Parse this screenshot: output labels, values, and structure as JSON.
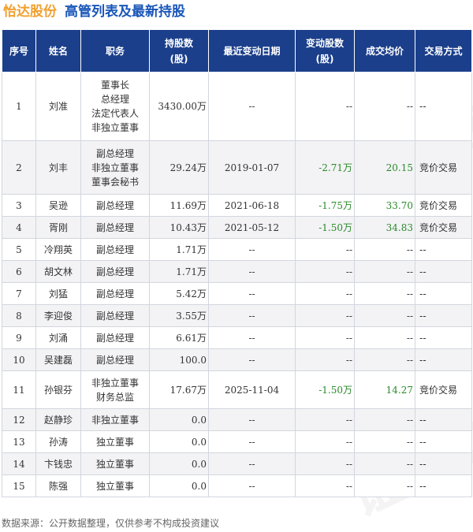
{
  "header": {
    "company": "怡达股份",
    "subtitle": "高管列表及最新持股"
  },
  "columns": [
    "序号",
    "姓名",
    "职务",
    "持股数\n(股)",
    "最近变动日期",
    "变动股数\n(股)",
    "成交均价",
    "交易方式"
  ],
  "rows": [
    {
      "no": "1",
      "name": "刘准",
      "positions": [
        "董事长",
        "总经理",
        "法定代表人",
        "非独立董事"
      ],
      "shares": "3430.00万",
      "date": "--",
      "change": "--",
      "price": "--",
      "method": "--"
    },
    {
      "no": "2",
      "name": "刘丰",
      "positions": [
        "副总经理",
        "非独立董事",
        "董事会秘书"
      ],
      "shares": "29.24万",
      "date": "2019-01-07",
      "change": "-2.71万",
      "price": "20.15",
      "method": "竞价交易"
    },
    {
      "no": "3",
      "name": "吴逊",
      "positions": [
        "副总经理"
      ],
      "shares": "11.69万",
      "date": "2021-06-18",
      "change": "-1.75万",
      "price": "33.70",
      "method": "竞价交易"
    },
    {
      "no": "4",
      "name": "胥刚",
      "positions": [
        "副总经理"
      ],
      "shares": "10.43万",
      "date": "2021-05-12",
      "change": "-1.50万",
      "price": "34.83",
      "method": "竞价交易"
    },
    {
      "no": "5",
      "name": "冷翔英",
      "positions": [
        "副总经理"
      ],
      "shares": "1.71万",
      "date": "--",
      "change": "--",
      "price": "--",
      "method": "--"
    },
    {
      "no": "6",
      "name": "胡文林",
      "positions": [
        "副总经理"
      ],
      "shares": "1.71万",
      "date": "--",
      "change": "--",
      "price": "--",
      "method": "--"
    },
    {
      "no": "7",
      "name": "刘猛",
      "positions": [
        "副总经理"
      ],
      "shares": "5.42万",
      "date": "--",
      "change": "--",
      "price": "--",
      "method": "--"
    },
    {
      "no": "8",
      "name": "李迎俊",
      "positions": [
        "副总经理"
      ],
      "shares": "3.55万",
      "date": "--",
      "change": "--",
      "price": "--",
      "method": "--"
    },
    {
      "no": "9",
      "name": "刘涌",
      "positions": [
        "副总经理"
      ],
      "shares": "6.61万",
      "date": "--",
      "change": "--",
      "price": "--",
      "method": "--"
    },
    {
      "no": "10",
      "name": "吴建磊",
      "positions": [
        "副总经理"
      ],
      "shares": "100.0",
      "date": "--",
      "change": "--",
      "price": "--",
      "method": "--"
    },
    {
      "no": "11",
      "name": "孙银芬",
      "positions": [
        "非独立董事",
        "财务总监"
      ],
      "shares": "17.67万",
      "date": "2025-11-04",
      "change": "-1.50万",
      "price": "14.27",
      "method": "竞价交易"
    },
    {
      "no": "12",
      "name": "赵静珍",
      "positions": [
        "非独立董事"
      ],
      "shares": "0.0",
      "date": "--",
      "change": "--",
      "price": "--",
      "method": "--"
    },
    {
      "no": "13",
      "name": "孙涛",
      "positions": [
        "独立董事"
      ],
      "shares": "0.0",
      "date": "--",
      "change": "--",
      "price": "--",
      "method": "--"
    },
    {
      "no": "14",
      "name": "卞钱忠",
      "positions": [
        "独立董事"
      ],
      "shares": "0.0",
      "date": "--",
      "change": "--",
      "price": "--",
      "method": "--"
    },
    {
      "no": "15",
      "name": "陈强",
      "positions": [
        "独立董事"
      ],
      "shares": "0.0",
      "date": "--",
      "change": "--",
      "price": "--",
      "method": "--"
    }
  ],
  "footer": "数据来源：公开数据整理，仅供参考不构成投资建议",
  "watermark": "证券之星",
  "colors": {
    "header_bg": "#1b3f8b",
    "company": "#f0a030",
    "subtitle": "#1a56b8",
    "change_value": "#2a8a2a"
  }
}
